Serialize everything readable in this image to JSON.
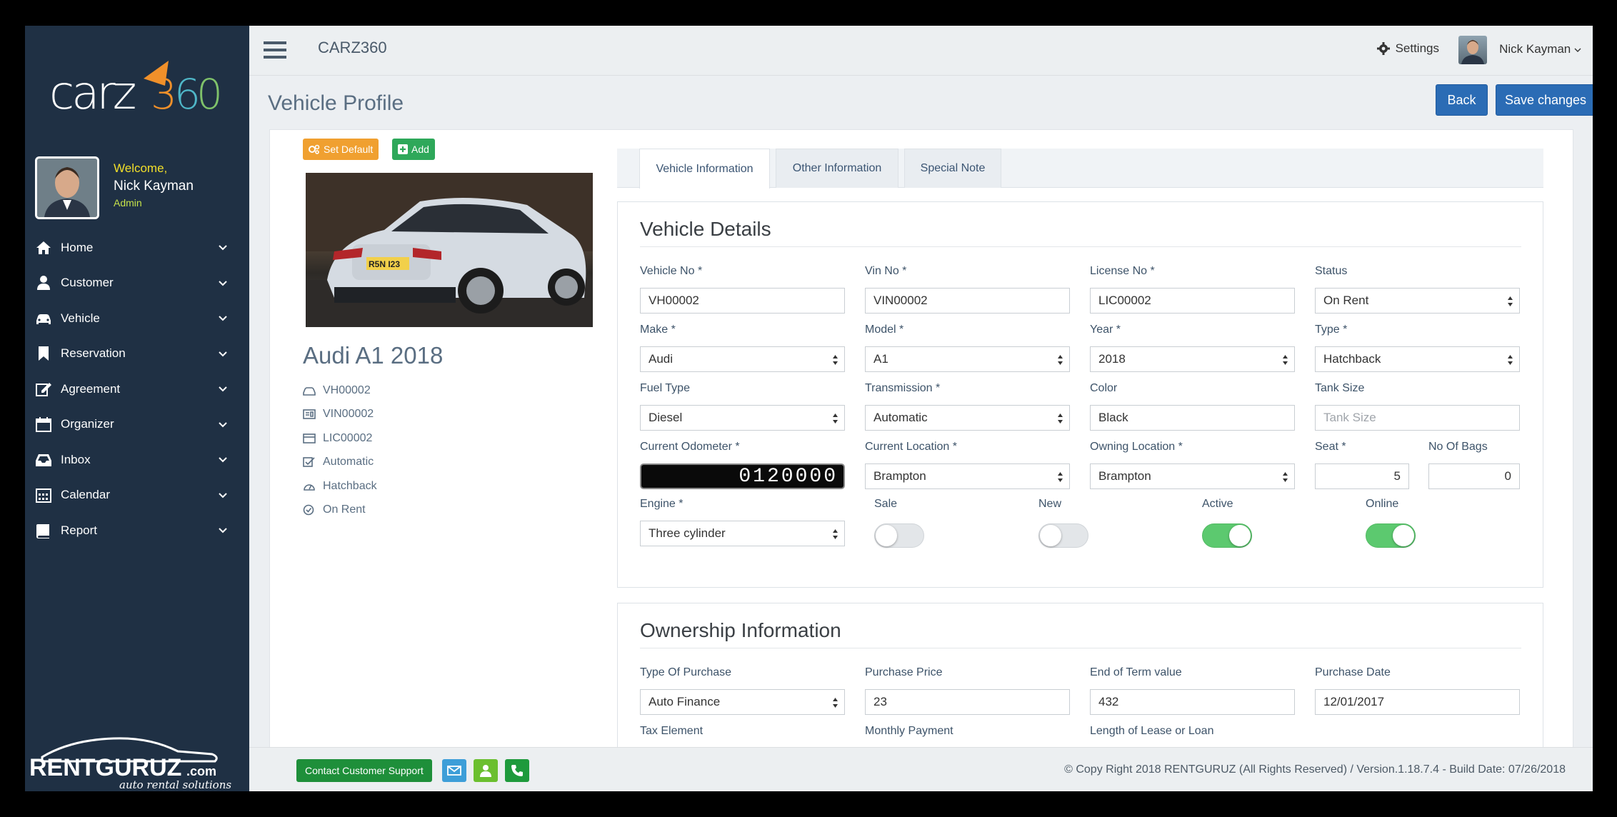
{
  "app": {
    "name": "CARZ360",
    "logo_text": "carz360",
    "brand_text": "RENTGURUZ.com",
    "brand_sub": "auto rental solutions"
  },
  "topbar": {
    "settings_label": "Settings",
    "user_name": "Nick Kayman"
  },
  "sidebar": {
    "welcome": "Welcome,",
    "user_name": "Nick Kayman",
    "role": "Admin",
    "items": [
      {
        "label": "Home",
        "icon": "home-icon"
      },
      {
        "label": "Customer",
        "icon": "user-icon"
      },
      {
        "label": "Vehicle",
        "icon": "car-icon"
      },
      {
        "label": "Reservation",
        "icon": "bookmark-icon"
      },
      {
        "label": "Agreement",
        "icon": "edit-icon"
      },
      {
        "label": "Organizer",
        "icon": "calendar-icon"
      },
      {
        "label": "Inbox",
        "icon": "inbox-icon"
      },
      {
        "label": "Calendar",
        "icon": "calendar-grid-icon"
      },
      {
        "label": "Report",
        "icon": "book-icon"
      }
    ]
  },
  "page": {
    "title": "Vehicle Profile",
    "back_label": "Back",
    "save_label": "Save changes"
  },
  "vehicle_summary": {
    "set_default_label": "Set Default",
    "add_label": "Add",
    "title": "Audi A1 2018",
    "vehicle_no": "VH00002",
    "vin_no": "VIN00002",
    "license_no": "LIC00002",
    "transmission": "Automatic",
    "type": "Hatchback",
    "status": "On Rent"
  },
  "tabs": [
    "Vehicle Information",
    "Other Information",
    "Special Note"
  ],
  "details": {
    "heading": "Vehicle Details",
    "vehicle_no": {
      "label": "Vehicle No *",
      "value": "VH00002"
    },
    "vin_no": {
      "label": "Vin No *",
      "value": "VIN00002"
    },
    "license_no": {
      "label": "License No *",
      "value": "LIC00002"
    },
    "status": {
      "label": "Status",
      "value": "On Rent"
    },
    "make": {
      "label": "Make *",
      "value": "Audi"
    },
    "model": {
      "label": "Model *",
      "value": "A1"
    },
    "year": {
      "label": "Year *",
      "value": "2018"
    },
    "type": {
      "label": "Type *",
      "value": "Hatchback"
    },
    "fuel_type": {
      "label": "Fuel Type",
      "value": "Diesel"
    },
    "transmission": {
      "label": "Transmission *",
      "value": "Automatic"
    },
    "color": {
      "label": "Color",
      "value": "Black"
    },
    "tank_size": {
      "label": "Tank Size",
      "placeholder": "Tank Size"
    },
    "odometer": {
      "label": "Current Odometer *",
      "value": "0120000"
    },
    "current_location": {
      "label": "Current Location *",
      "value": "Brampton"
    },
    "owning_location": {
      "label": "Owning Location *",
      "value": "Brampton"
    },
    "seat": {
      "label": "Seat *",
      "value": "5"
    },
    "bags": {
      "label": "No Of Bags",
      "value": "0"
    },
    "engine": {
      "label": "Engine *",
      "value": "Three cylinder"
    },
    "sale": {
      "label": "Sale",
      "on": false
    },
    "new": {
      "label": "New",
      "on": false
    },
    "active": {
      "label": "Active",
      "on": true
    },
    "online": {
      "label": "Online",
      "on": true
    }
  },
  "ownership": {
    "heading": "Ownership Information",
    "type_of_purchase": {
      "label": "Type Of Purchase",
      "value": "Auto Finance"
    },
    "purchase_price": {
      "label": "Purchase Price",
      "value": "23"
    },
    "end_of_term": {
      "label": "End of Term value",
      "value": "432"
    },
    "purchase_date": {
      "label": "Purchase Date",
      "value": "12/01/2017"
    },
    "tax_element": {
      "label": "Tax Element"
    },
    "monthly_payment": {
      "label": "Monthly Payment"
    },
    "length_of_lease": {
      "label": "Length of Lease or Loan"
    }
  },
  "footer": {
    "support_label": "Contact Customer Support",
    "copyright": "© Copy Right 2018 RENTGURUZ (All Rights Reserved) / Version.1.18.7.4 - Build Date: 07/26/2018"
  },
  "colors": {
    "sidebar": "#1f3044",
    "primary": "#2b6cb5",
    "orange": "#f0a030",
    "green": "#2ea85a",
    "toggle_on": "#5cc96f"
  }
}
